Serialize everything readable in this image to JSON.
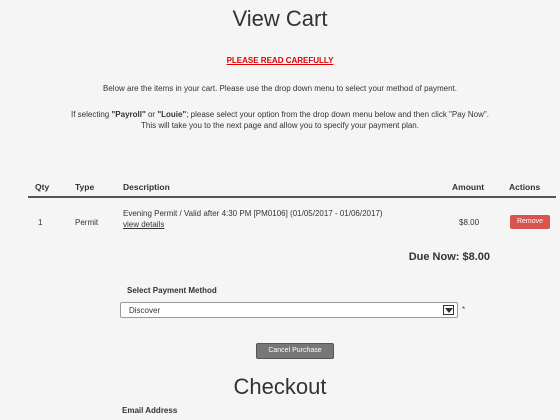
{
  "page": {
    "title": "View Cart"
  },
  "notice": {
    "text": "PLEASE READ CAREFULLY"
  },
  "instructions": {
    "line1": "Below are the items in your cart. Please use the drop down menu to select your method of payment.",
    "line2_prefix": "If selecting ",
    "line2_payroll": "\"Payroll\"",
    "line2_or": " or ",
    "line2_louie": "\"Louie\"",
    "line2_suffix": "; please select your option from the drop down menu below and then click \"Pay Now\".",
    "line3": "This will take you to the next page and allow you to specify your payment plan."
  },
  "cart": {
    "columns": {
      "qty": "Qty",
      "type": "Type",
      "description": "Description",
      "amount": "Amount",
      "actions": "Actions"
    },
    "rows": [
      {
        "qty": "1",
        "type": "Permit",
        "description": "Evening Permit / Valid after 4:30 PM [PM0106] (01/05/2017 - 01/06/2017)",
        "details_link": "view details",
        "amount": "$8.00",
        "action": "Remove"
      }
    ]
  },
  "due_now": "Due Now: $8.00",
  "payment": {
    "label": "Select Payment Method",
    "selected": "Discover",
    "required_mark": "*"
  },
  "cancel_button": "Cancel Purchase",
  "checkout": {
    "title": "Checkout",
    "email_label": "Email Address"
  },
  "colors": {
    "danger": "#d9534f",
    "notice": "#e00000",
    "secondary": "#777777"
  }
}
